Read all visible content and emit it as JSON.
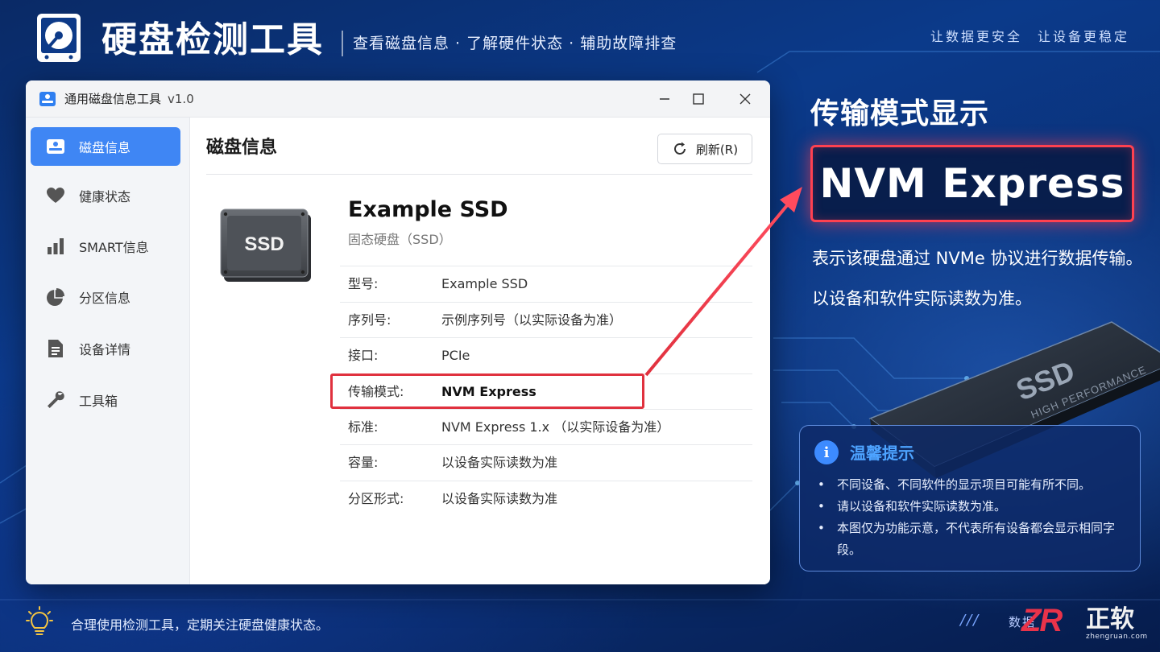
{
  "header": {
    "title": "硬盘检测工具",
    "subtitle": "查看磁盘信息 · 了解硬件状态 · 辅助故障排查",
    "slogan": "让数据更安全　让设备更稳定"
  },
  "window": {
    "title": "通用磁盘信息工具",
    "version": "v1.0",
    "sidebar": {
      "items": [
        {
          "label": "磁盘信息",
          "icon": "drive-icon",
          "active": true
        },
        {
          "label": "健康状态",
          "icon": "heart-icon",
          "active": false
        },
        {
          "label": "SMART信息",
          "icon": "bar-chart-icon",
          "active": false
        },
        {
          "label": "分区信息",
          "icon": "pie-chart-icon",
          "active": false
        },
        {
          "label": "设备详情",
          "icon": "document-icon",
          "active": false
        },
        {
          "label": "工具箱",
          "icon": "wrench-icon",
          "active": false
        }
      ]
    },
    "main": {
      "title": "磁盘信息",
      "refresh_label": "刷新(R)",
      "device_image_label": "SSD",
      "device_name": "Example SSD",
      "device_type": "固态硬盘（SSD）",
      "rows": [
        {
          "key": "型号:",
          "value": "Example SSD"
        },
        {
          "key": "序列号:",
          "value": "示例序列号（以实际设备为准）"
        },
        {
          "key": "接口:",
          "value": "PCIe"
        },
        {
          "key": "传输模式:",
          "value": "NVM Express",
          "highlight": true
        },
        {
          "key": "标准:",
          "value": "NVM Express 1.x （以实际设备为准）"
        },
        {
          "key": "容量:",
          "value": "以设备实际读数为准"
        },
        {
          "key": "分区形式:",
          "value": "以设备实际读数为准"
        }
      ]
    }
  },
  "callout": {
    "title": "传输模式显示",
    "value": "NVM Express",
    "desc1": "表示该硬盘通过 NVMe 协议进行数据传输。",
    "desc2": "以设备和软件实际读数为准。",
    "accent": "#ff4150"
  },
  "ssd_render": {
    "brand": "SSD",
    "tagline": "HIGH PERFORMANCE"
  },
  "tips": {
    "title": "温馨提示",
    "icon_glyph": "i",
    "items": [
      "不同设备、不同软件的显示项目可能有所不同。",
      "请以设备和软件实际读数为准。",
      "本图仅为功能示意，不代表所有设备都会显示相同字段。"
    ]
  },
  "footer": {
    "text": "合理使用检测工具，定期关注硬盘健康状态。",
    "slashes": "///",
    "right_text": "数据"
  },
  "brand": {
    "mark": "ZR",
    "name": "正软",
    "url": "zhengruan.com"
  },
  "colors": {
    "active_nav": "#3f86f4",
    "highlight_red": "#e0313e",
    "tips_title": "#4da3ff"
  }
}
